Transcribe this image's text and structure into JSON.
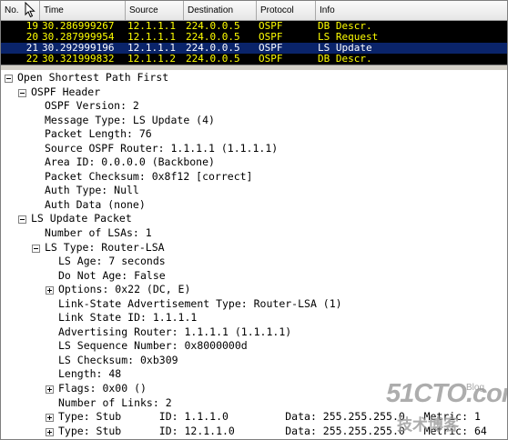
{
  "packet_list": {
    "columns": [
      "No.",
      "Time",
      "Source",
      "Destination",
      "Protocol",
      "Info"
    ],
    "rows": [
      {
        "no": "19",
        "time": "30.286999267",
        "source": "12.1.1.1",
        "destination": "224.0.0.5",
        "protocol": "OSPF",
        "info": "DB Descr.",
        "selected": false
      },
      {
        "no": "20",
        "time": "30.287999954",
        "source": "12.1.1.1",
        "destination": "224.0.0.5",
        "protocol": "OSPF",
        "info": "LS Request",
        "selected": false
      },
      {
        "no": "21",
        "time": "30.292999196",
        "source": "12.1.1.1",
        "destination": "224.0.0.5",
        "protocol": "OSPF",
        "info": "LS Update",
        "selected": true
      },
      {
        "no": "22",
        "time": "30.321999832",
        "source": "12.1.1.2",
        "destination": "224.0.0.5",
        "protocol": "OSPF",
        "info": "DB Descr.",
        "selected": false
      }
    ]
  },
  "detail_tree": [
    {
      "depth": 0,
      "toggle": "minus",
      "text": "Open Shortest Path First"
    },
    {
      "depth": 1,
      "toggle": "minus",
      "text": "OSPF Header"
    },
    {
      "depth": 2,
      "toggle": "none",
      "text": "OSPF Version: 2"
    },
    {
      "depth": 2,
      "toggle": "none",
      "text": "Message Type: LS Update (4)"
    },
    {
      "depth": 2,
      "toggle": "none",
      "text": "Packet Length: 76"
    },
    {
      "depth": 2,
      "toggle": "none",
      "text": "Source OSPF Router: 1.1.1.1 (1.1.1.1)"
    },
    {
      "depth": 2,
      "toggle": "none",
      "text": "Area ID: 0.0.0.0 (Backbone)"
    },
    {
      "depth": 2,
      "toggle": "none",
      "text": "Packet Checksum: 0x8f12 [correct]"
    },
    {
      "depth": 2,
      "toggle": "none",
      "text": "Auth Type: Null"
    },
    {
      "depth": 2,
      "toggle": "none",
      "text": "Auth Data (none)"
    },
    {
      "depth": 1,
      "toggle": "minus",
      "text": "LS Update Packet"
    },
    {
      "depth": 2,
      "toggle": "none",
      "text": "Number of LSAs: 1"
    },
    {
      "depth": 2,
      "toggle": "minus",
      "text": "LS Type: Router-LSA"
    },
    {
      "depth": 3,
      "toggle": "none",
      "text": "LS Age: 7 seconds"
    },
    {
      "depth": 3,
      "toggle": "none",
      "text": "Do Not Age: False"
    },
    {
      "depth": 3,
      "toggle": "plus",
      "text": "Options: 0x22 (DC, E)"
    },
    {
      "depth": 3,
      "toggle": "none",
      "text": "Link-State Advertisement Type: Router-LSA (1)"
    },
    {
      "depth": 3,
      "toggle": "none",
      "text": "Link State ID: 1.1.1.1"
    },
    {
      "depth": 3,
      "toggle": "none",
      "text": "Advertising Router: 1.1.1.1 (1.1.1.1)"
    },
    {
      "depth": 3,
      "toggle": "none",
      "text": "LS Sequence Number: 0x8000000d"
    },
    {
      "depth": 3,
      "toggle": "none",
      "text": "LS Checksum: 0xb309"
    },
    {
      "depth": 3,
      "toggle": "none",
      "text": "Length: 48"
    },
    {
      "depth": 3,
      "toggle": "plus",
      "text": "Flags: 0x00 ()"
    },
    {
      "depth": 3,
      "toggle": "none",
      "text": "Number of Links: 2"
    },
    {
      "depth": 3,
      "toggle": "plus",
      "text": "Type: Stub      ID: 1.1.1.0         Data: 255.255.255.0   Metric: 1"
    },
    {
      "depth": 3,
      "toggle": "plus",
      "text": "Type: Stub      ID: 12.1.1.0        Data: 255.255.255.0   Metric: 64"
    }
  ],
  "watermark": {
    "logo": "51CTO.com",
    "sub": "技术博客",
    "blog": "Blog"
  },
  "colors": {
    "list_bg": "#000000",
    "list_text": "#ffff00",
    "selected_bg": "#0a246a",
    "selected_text": "#ffffff"
  }
}
